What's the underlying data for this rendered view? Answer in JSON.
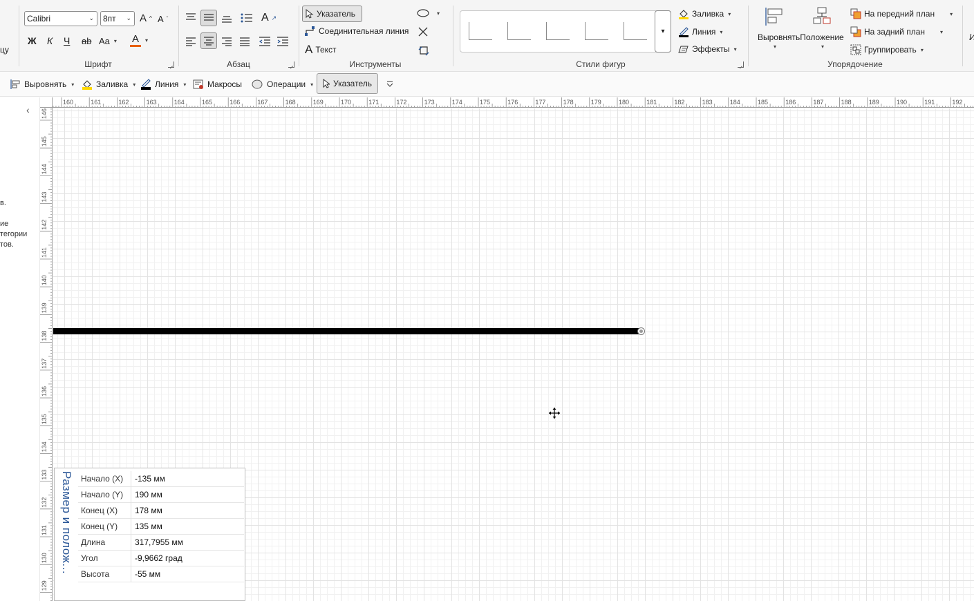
{
  "ribbon": {
    "font_group": {
      "font_name": "Calibri",
      "font_size": "8пт",
      "label": "Шрифт",
      "bold": "Ж",
      "italic": "К",
      "underline": "Ч",
      "strike": "ab",
      "case": "Aa"
    },
    "paragraph_group": {
      "label": "Абзац"
    },
    "tools_group": {
      "label": "Инструменты",
      "pointer": "Указатель",
      "connector": "Соединительная линия",
      "text": "Текст"
    },
    "shape_styles_group": {
      "label": "Стили фигур"
    },
    "format_group": {
      "fill": "Заливка",
      "line": "Линия",
      "effects": "Эффекты"
    },
    "arrange_group": {
      "label": "Упорядочение",
      "align": "Выровнять",
      "position": "Положение",
      "bring_front": "На передний план",
      "send_back": "На задний план",
      "group": "Группировать"
    },
    "clipped_left": "цу",
    "clipped_right": "И"
  },
  "qat": {
    "align": "Выровнять",
    "fill": "Заливка",
    "line": "Линия",
    "macros": "Макросы",
    "operations": "Операции",
    "pointer": "Указатель"
  },
  "left_panel": {
    "line1": "в.",
    "line2": "ие",
    "line3": "тегории",
    "line4": "тов."
  },
  "ruler": {
    "horizontal": [
      "160",
      "161",
      "162",
      "163",
      "164",
      "165",
      "166",
      "167",
      "168",
      "169",
      "170",
      "171",
      "172",
      "173",
      "174",
      "175",
      "176",
      "177",
      "178",
      "179",
      "180",
      "181",
      "182",
      "183",
      "184",
      "185",
      "186",
      "187",
      "188",
      "189",
      "190",
      "191",
      "192"
    ],
    "vertical": [
      "146",
      "145",
      "144",
      "143",
      "142",
      "141",
      "140",
      "139",
      "138",
      "137",
      "136",
      "135",
      "134",
      "133",
      "132",
      "131",
      "130",
      "129"
    ]
  },
  "size_position": {
    "title": "Размер и полож...",
    "rows": [
      {
        "label": "Начало (X)",
        "value": "-135 мм"
      },
      {
        "label": "Начало (Y)",
        "value": "190 мм"
      },
      {
        "label": "Конец (X)",
        "value": "178 мм"
      },
      {
        "label": "Конец (Y)",
        "value": "135 мм"
      },
      {
        "label": "Длина",
        "value": "317,7955 мм"
      },
      {
        "label": "Угол",
        "value": "-9,9662 град"
      },
      {
        "label": "Высота",
        "value": "-55 мм"
      }
    ]
  },
  "colors": {
    "accent_title": "#2b5797",
    "fill_swatch": "#ffd800",
    "font_color_swatch": "#e8600a",
    "line_swatch": "#000000"
  }
}
